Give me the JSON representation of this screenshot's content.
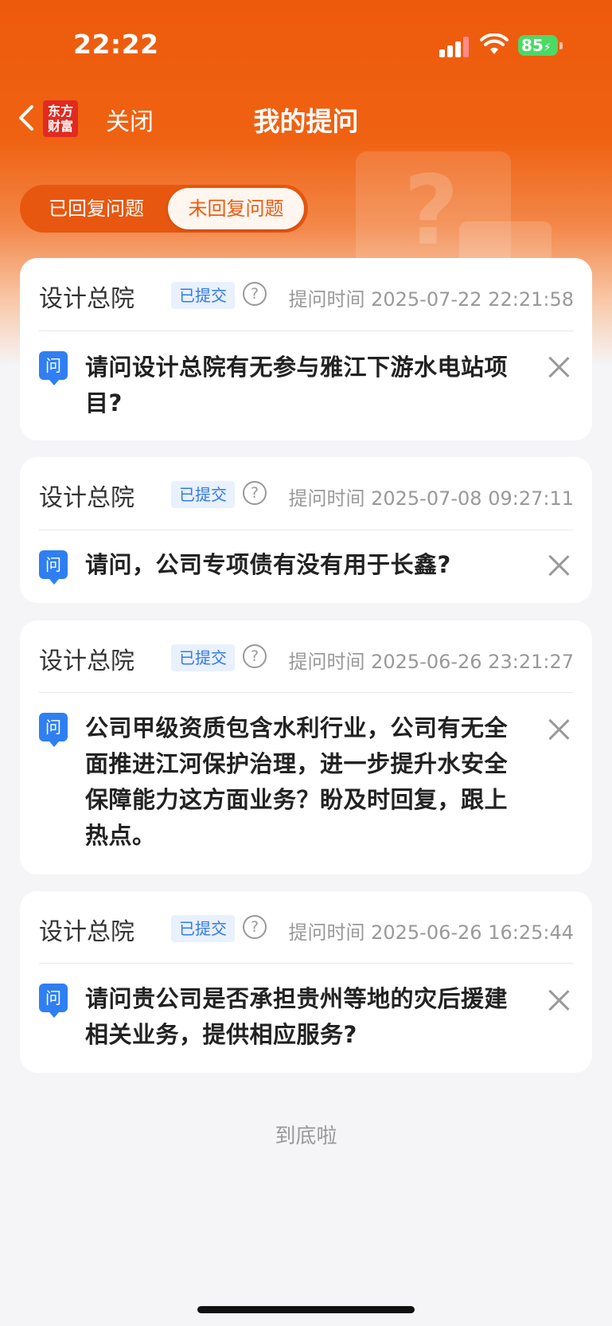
{
  "status_bar": {
    "time": "22:22",
    "battery": "85"
  },
  "nav": {
    "logo_line1": "东方",
    "logo_line2": "财富",
    "close_label": "关闭",
    "title": "我的提问"
  },
  "tabs": [
    {
      "label": "已回复问题",
      "selected": false
    },
    {
      "label": "未回复问题",
      "selected": true
    }
  ],
  "questions": [
    {
      "company": "设计总院",
      "status": "已提交",
      "time": "提问时间 2025-07-22 22:21:58",
      "icon": "问",
      "text": "请问设计总院有无参与雅江下游水电站项目?"
    },
    {
      "company": "设计总院",
      "status": "已提交",
      "time": "提问时间 2025-07-08 09:27:11",
      "icon": "问",
      "text": "请问，公司专项债有没有用于长鑫?"
    },
    {
      "company": "设计总院",
      "status": "已提交",
      "time": "提问时间 2025-06-26 23:21:27",
      "icon": "问",
      "text": "公司甲级资质包含水利行业，公司有无全面推进江河保护治理，进一步提升水安全保障能力这方面业务？盼及时回复，跟上热点。"
    },
    {
      "company": "设计总院",
      "status": "已提交",
      "time": "提问时间 2025-06-26 16:25:44",
      "icon": "问",
      "text": "请问贵公司是否承担贵州等地的灾后援建相关业务，提供相应服务?"
    }
  ],
  "footer": "到底啦",
  "colors": {
    "brand_orange": "#ee5a0c",
    "badge_blue": "#3579e8",
    "question_icon_blue": "#2f7ff2"
  }
}
